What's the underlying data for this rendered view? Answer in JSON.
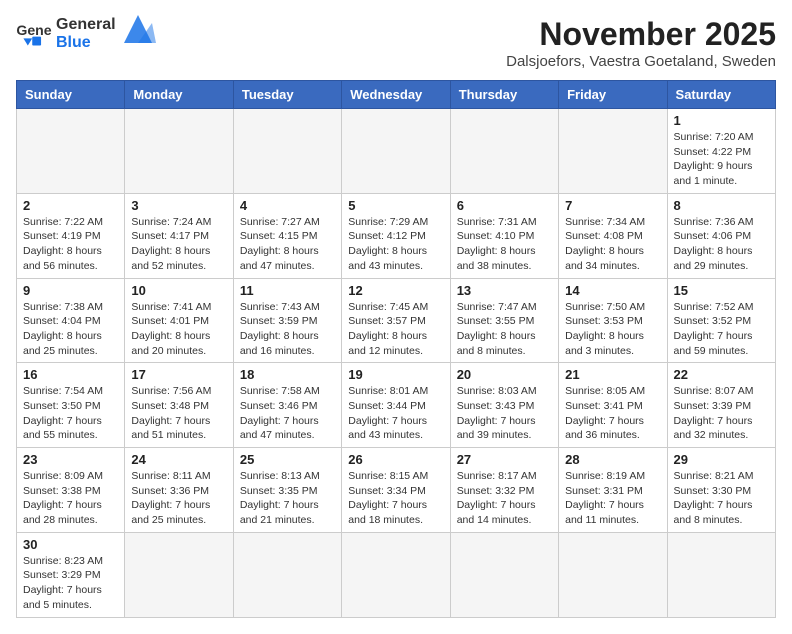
{
  "header": {
    "logo_general": "General",
    "logo_blue": "Blue",
    "month": "November 2025",
    "location": "Dalsjoefors, Vaestra Goetaland, Sweden"
  },
  "days_of_week": [
    "Sunday",
    "Monday",
    "Tuesday",
    "Wednesday",
    "Thursday",
    "Friday",
    "Saturday"
  ],
  "weeks": [
    [
      {
        "day": "",
        "info": ""
      },
      {
        "day": "",
        "info": ""
      },
      {
        "day": "",
        "info": ""
      },
      {
        "day": "",
        "info": ""
      },
      {
        "day": "",
        "info": ""
      },
      {
        "day": "",
        "info": ""
      },
      {
        "day": "1",
        "info": "Sunrise: 7:20 AM\nSunset: 4:22 PM\nDaylight: 9 hours\nand 1 minute."
      }
    ],
    [
      {
        "day": "2",
        "info": "Sunrise: 7:22 AM\nSunset: 4:19 PM\nDaylight: 8 hours\nand 56 minutes."
      },
      {
        "day": "3",
        "info": "Sunrise: 7:24 AM\nSunset: 4:17 PM\nDaylight: 8 hours\nand 52 minutes."
      },
      {
        "day": "4",
        "info": "Sunrise: 7:27 AM\nSunset: 4:15 PM\nDaylight: 8 hours\nand 47 minutes."
      },
      {
        "day": "5",
        "info": "Sunrise: 7:29 AM\nSunset: 4:12 PM\nDaylight: 8 hours\nand 43 minutes."
      },
      {
        "day": "6",
        "info": "Sunrise: 7:31 AM\nSunset: 4:10 PM\nDaylight: 8 hours\nand 38 minutes."
      },
      {
        "day": "7",
        "info": "Sunrise: 7:34 AM\nSunset: 4:08 PM\nDaylight: 8 hours\nand 34 minutes."
      },
      {
        "day": "8",
        "info": "Sunrise: 7:36 AM\nSunset: 4:06 PM\nDaylight: 8 hours\nand 29 minutes."
      }
    ],
    [
      {
        "day": "9",
        "info": "Sunrise: 7:38 AM\nSunset: 4:04 PM\nDaylight: 8 hours\nand 25 minutes."
      },
      {
        "day": "10",
        "info": "Sunrise: 7:41 AM\nSunset: 4:01 PM\nDaylight: 8 hours\nand 20 minutes."
      },
      {
        "day": "11",
        "info": "Sunrise: 7:43 AM\nSunset: 3:59 PM\nDaylight: 8 hours\nand 16 minutes."
      },
      {
        "day": "12",
        "info": "Sunrise: 7:45 AM\nSunset: 3:57 PM\nDaylight: 8 hours\nand 12 minutes."
      },
      {
        "day": "13",
        "info": "Sunrise: 7:47 AM\nSunset: 3:55 PM\nDaylight: 8 hours\nand 8 minutes."
      },
      {
        "day": "14",
        "info": "Sunrise: 7:50 AM\nSunset: 3:53 PM\nDaylight: 8 hours\nand 3 minutes."
      },
      {
        "day": "15",
        "info": "Sunrise: 7:52 AM\nSunset: 3:52 PM\nDaylight: 7 hours\nand 59 minutes."
      }
    ],
    [
      {
        "day": "16",
        "info": "Sunrise: 7:54 AM\nSunset: 3:50 PM\nDaylight: 7 hours\nand 55 minutes."
      },
      {
        "day": "17",
        "info": "Sunrise: 7:56 AM\nSunset: 3:48 PM\nDaylight: 7 hours\nand 51 minutes."
      },
      {
        "day": "18",
        "info": "Sunrise: 7:58 AM\nSunset: 3:46 PM\nDaylight: 7 hours\nand 47 minutes."
      },
      {
        "day": "19",
        "info": "Sunrise: 8:01 AM\nSunset: 3:44 PM\nDaylight: 7 hours\nand 43 minutes."
      },
      {
        "day": "20",
        "info": "Sunrise: 8:03 AM\nSunset: 3:43 PM\nDaylight: 7 hours\nand 39 minutes."
      },
      {
        "day": "21",
        "info": "Sunrise: 8:05 AM\nSunset: 3:41 PM\nDaylight: 7 hours\nand 36 minutes."
      },
      {
        "day": "22",
        "info": "Sunrise: 8:07 AM\nSunset: 3:39 PM\nDaylight: 7 hours\nand 32 minutes."
      }
    ],
    [
      {
        "day": "23",
        "info": "Sunrise: 8:09 AM\nSunset: 3:38 PM\nDaylight: 7 hours\nand 28 minutes."
      },
      {
        "day": "24",
        "info": "Sunrise: 8:11 AM\nSunset: 3:36 PM\nDaylight: 7 hours\nand 25 minutes."
      },
      {
        "day": "25",
        "info": "Sunrise: 8:13 AM\nSunset: 3:35 PM\nDaylight: 7 hours\nand 21 minutes."
      },
      {
        "day": "26",
        "info": "Sunrise: 8:15 AM\nSunset: 3:34 PM\nDaylight: 7 hours\nand 18 minutes."
      },
      {
        "day": "27",
        "info": "Sunrise: 8:17 AM\nSunset: 3:32 PM\nDaylight: 7 hours\nand 14 minutes."
      },
      {
        "day": "28",
        "info": "Sunrise: 8:19 AM\nSunset: 3:31 PM\nDaylight: 7 hours\nand 11 minutes."
      },
      {
        "day": "29",
        "info": "Sunrise: 8:21 AM\nSunset: 3:30 PM\nDaylight: 7 hours\nand 8 minutes."
      }
    ],
    [
      {
        "day": "30",
        "info": "Sunrise: 8:23 AM\nSunset: 3:29 PM\nDaylight: 7 hours\nand 5 minutes."
      },
      {
        "day": "",
        "info": ""
      },
      {
        "day": "",
        "info": ""
      },
      {
        "day": "",
        "info": ""
      },
      {
        "day": "",
        "info": ""
      },
      {
        "day": "",
        "info": ""
      },
      {
        "day": "",
        "info": ""
      }
    ]
  ]
}
